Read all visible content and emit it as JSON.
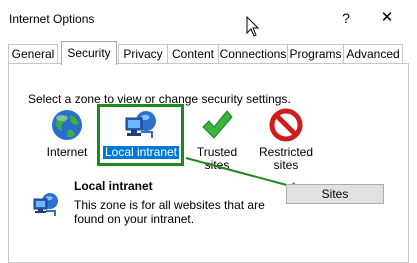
{
  "window": {
    "title": "Internet Options",
    "help": "?",
    "close": "✕"
  },
  "tabs": [
    "General",
    "Security",
    "Privacy",
    "Content",
    "Connections",
    "Programs",
    "Advanced"
  ],
  "active_tab": "Security",
  "security": {
    "prompt": "Select a zone to view or change security settings.",
    "zones": [
      {
        "label": "Internet",
        "icon": "globe-icon"
      },
      {
        "label": "Local intranet",
        "icon": "local-intranet-icon",
        "selected": true
      },
      {
        "label": "Trusted sites",
        "icon": "check-icon"
      },
      {
        "label": "Restricted sites",
        "icon": "restricted-icon"
      }
    ],
    "info_title": "Local intranet",
    "info_desc": "This zone is for all websites that are found on your intranet.",
    "sites_button": "Sites"
  },
  "colors": {
    "highlight": "#1e8a1e",
    "selection": "#0078d7"
  }
}
